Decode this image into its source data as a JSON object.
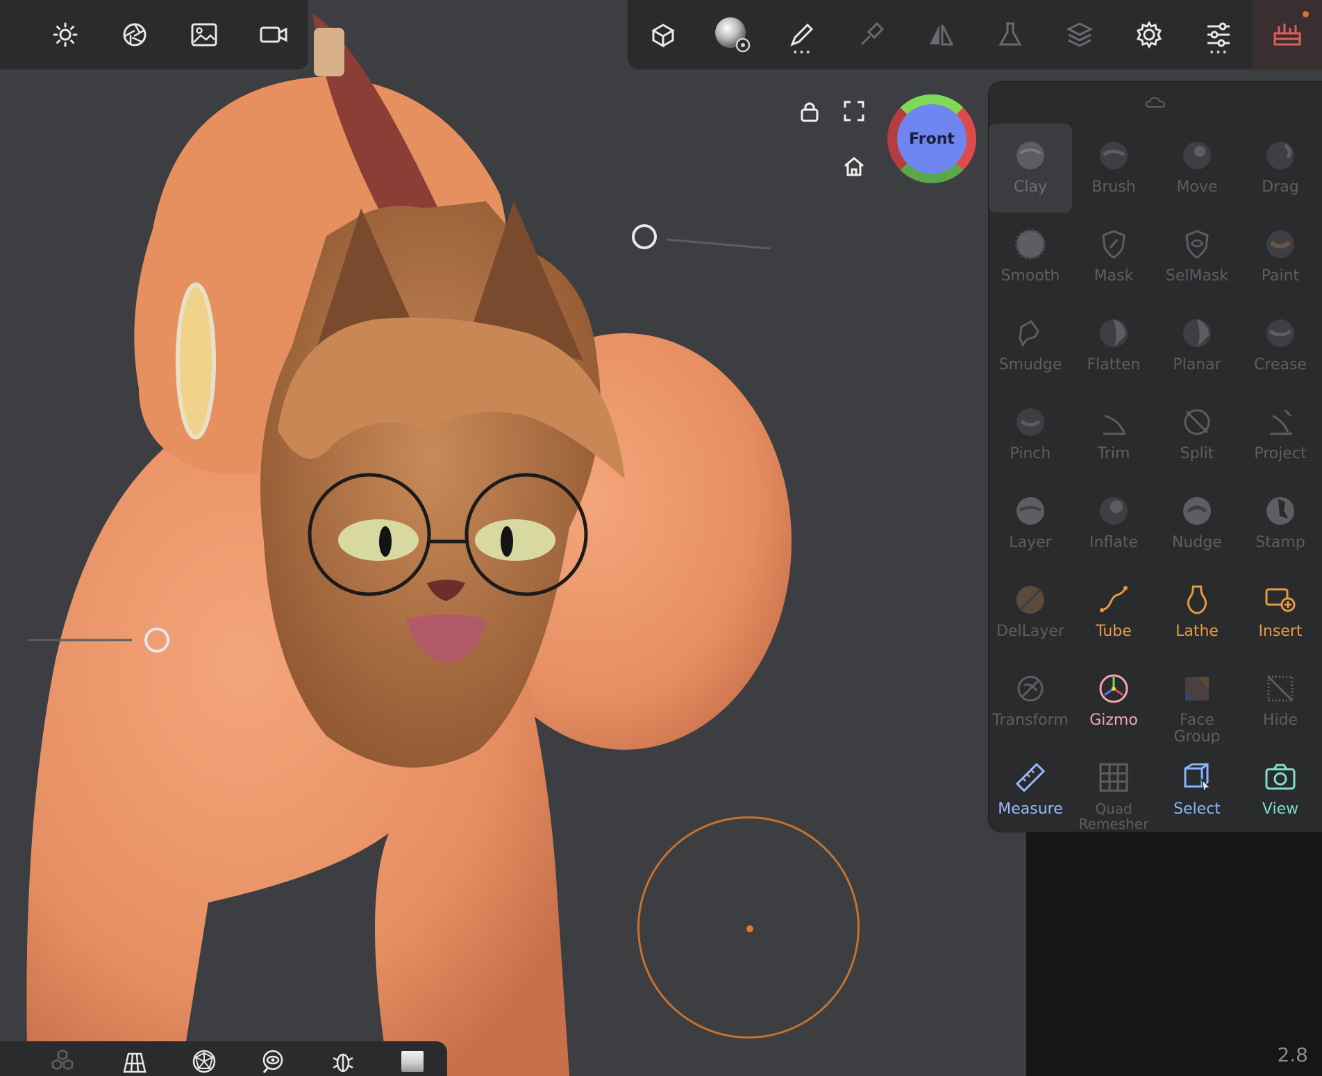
{
  "viewport": {
    "view_cube_label": "Front",
    "version": "2.8"
  },
  "top_left_toolbar": {
    "icons": [
      "sun-icon",
      "aperture-icon",
      "image-icon",
      "video-camera-icon"
    ]
  },
  "top_right_toolbar": {
    "icons": [
      "scene-box-icon",
      "material-sphere-icon",
      "brush-pen-icon",
      "painting-icon",
      "symmetry-icon",
      "flask-icon",
      "layers-icon",
      "settings-gear-icon",
      "sliders-icon",
      "tools-icon"
    ]
  },
  "tools": [
    {
      "label": "Clay",
      "state": "active"
    },
    {
      "label": "Brush",
      "state": "dim"
    },
    {
      "label": "Move",
      "state": "dim"
    },
    {
      "label": "Drag",
      "state": "dim"
    },
    {
      "label": "Smooth",
      "state": "dim"
    },
    {
      "label": "Mask",
      "state": "dim"
    },
    {
      "label": "SelMask",
      "state": "dim"
    },
    {
      "label": "Paint",
      "state": "dim"
    },
    {
      "label": "Smudge",
      "state": "dim"
    },
    {
      "label": "Flatten",
      "state": "dim"
    },
    {
      "label": "Planar",
      "state": "dim"
    },
    {
      "label": "Crease",
      "state": "dim"
    },
    {
      "label": "Pinch",
      "state": "dim"
    },
    {
      "label": "Trim",
      "state": "dim"
    },
    {
      "label": "Split",
      "state": "dim"
    },
    {
      "label": "Project",
      "state": "dim"
    },
    {
      "label": "Layer",
      "state": "dim"
    },
    {
      "label": "Inflate",
      "state": "dim"
    },
    {
      "label": "Nudge",
      "state": "dim"
    },
    {
      "label": "Stamp",
      "state": "dim"
    },
    {
      "label": "DelLayer",
      "state": "dim"
    },
    {
      "label": "Tube",
      "state": "orange"
    },
    {
      "label": "Lathe",
      "state": "orange"
    },
    {
      "label": "Insert",
      "state": "orange"
    },
    {
      "label": "Transform",
      "state": "dim"
    },
    {
      "label": "Gizmo",
      "state": "pink"
    },
    {
      "label": "Face Group",
      "state": "dim"
    },
    {
      "label": "Hide",
      "state": "dim"
    },
    {
      "label": "Measure",
      "state": "lightblue"
    },
    {
      "label": "Quad Remesher",
      "state": "dim"
    },
    {
      "label": "Select",
      "state": "blue"
    },
    {
      "label": "View",
      "state": "teal"
    }
  ],
  "bottom_toolbar": {
    "icons": [
      "cubes-icon",
      "wireframe-grid-icon",
      "sphere-wire-icon",
      "eye-icon",
      "bug-icon",
      "shading-box-icon"
    ]
  },
  "colors": {
    "accent_orange": "#e89a42",
    "brush_cursor": "#c7712e",
    "panel_bg": "#2a2b2d",
    "viewport_bg": "#3c3e41"
  }
}
